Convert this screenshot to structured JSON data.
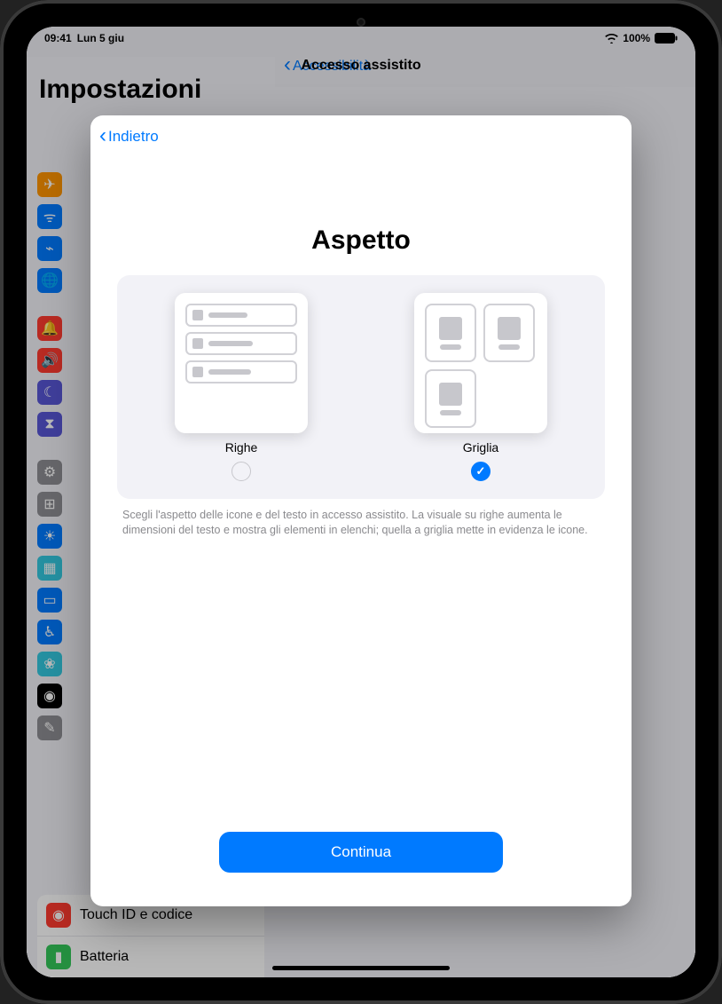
{
  "status": {
    "time": "09:41",
    "date": "Lun 5 giu",
    "battery_text": "100%"
  },
  "bg": {
    "back_label": "Accessibilità",
    "title": "Accesso assistito",
    "sidebar_large_title": "Impostazioni",
    "rows": {
      "touchid": "Touch ID e codice",
      "battery": "Batteria"
    }
  },
  "sheet": {
    "back_label": "Indietro",
    "title": "Aspetto",
    "options": {
      "rows_label": "Righe",
      "grid_label": "Griglia"
    },
    "helper": "Scegli l'aspetto delle icone e del testo in accesso assistito. La visuale su righe aumenta le dimensioni del testo e mostra gli elementi in elenchi; quella a griglia mette in evidenza le icone.",
    "continue_label": "Continua"
  }
}
